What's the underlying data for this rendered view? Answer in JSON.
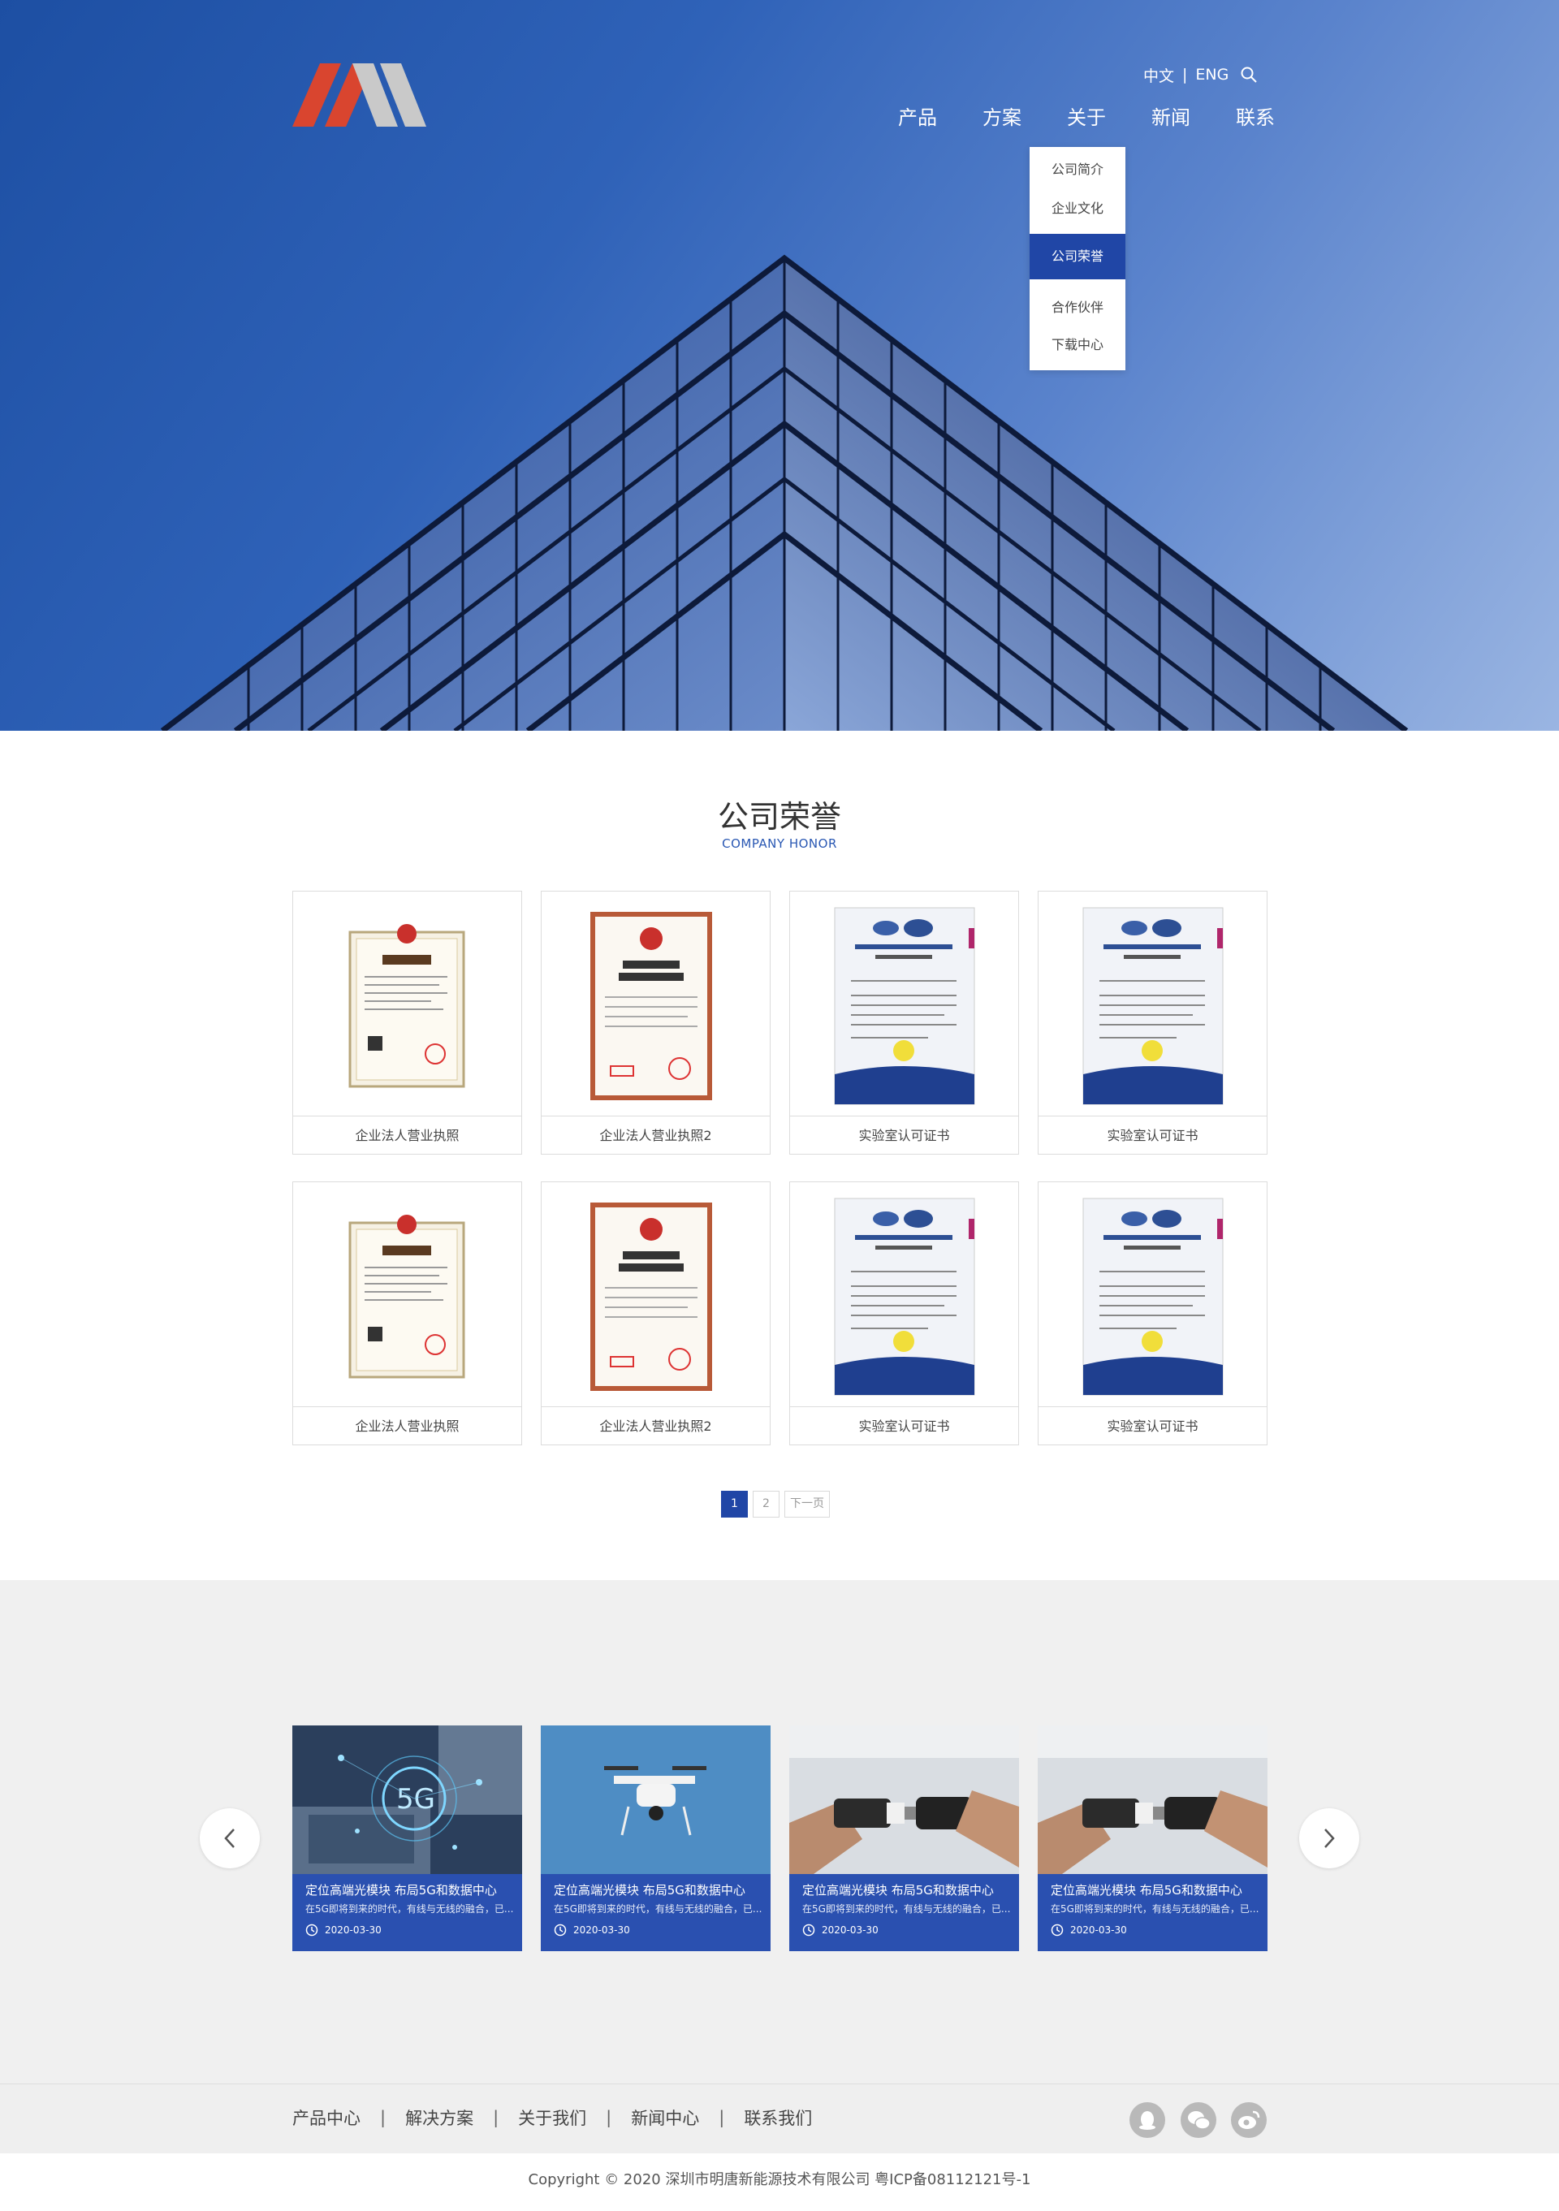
{
  "header": {
    "lang": {
      "cn": "中文",
      "sep": "|",
      "en": "ENG"
    },
    "nav": [
      "产品",
      "方案",
      "关于",
      "新闻",
      "联系"
    ],
    "dropdown": [
      "公司简介",
      "企业文化",
      "公司荣誉",
      "合作伙伴",
      "下载中心"
    ],
    "dropdown_active": "公司荣誉"
  },
  "section": {
    "title": "公司荣誉",
    "subtitle": "COMPANY HONOR"
  },
  "certificates": [
    {
      "caption": "企业法人营业执照"
    },
    {
      "caption": "企业法人营业执照2"
    },
    {
      "caption": "实验室认可证书"
    },
    {
      "caption": "实验室认可证书"
    },
    {
      "caption": "企业法人营业执照"
    },
    {
      "caption": "企业法人营业执照2"
    },
    {
      "caption": "实验室认可证书"
    },
    {
      "caption": "实验室认可证书"
    }
  ],
  "pagination": {
    "page1": "1",
    "page2": "2",
    "next": "下一页"
  },
  "news": [
    {
      "title": "定位高端光模块 布局5G和数据中心",
      "desc": "在5G即将到来的时代，有线与无线的融合，已...",
      "date": "2020-03-30",
      "image": "5g-tech"
    },
    {
      "title": "定位高端光模块 布局5G和数据中心",
      "desc": "在5G即将到来的时代，有线与无线的融合，已...",
      "date": "2020-03-30",
      "image": "drone"
    },
    {
      "title": "定位高端光模块 布局5G和数据中心",
      "desc": "在5G即将到来的时代，有线与无线的融合，已...",
      "date": "2020-03-30",
      "image": "connector-hands"
    },
    {
      "title": "定位高端光模块 布局5G和数据中心",
      "desc": "在5G即将到来的时代，有线与无线的融合，已...",
      "date": "2020-03-30",
      "image": "connector-hands"
    }
  ],
  "footer": {
    "links": [
      "产品中心",
      "解决方案",
      "关于我们",
      "新闻中心",
      "联系我们"
    ],
    "sep": "|",
    "copyright": "Copyright © 2020  深圳市明唐新能源技术有限公司  粤ICP备08112121号-1"
  },
  "colors": {
    "primary": "#2046a6",
    "news_card": "#2a50b0",
    "logo_red": "#d9452f",
    "logo_gray": "#c9c9c9"
  }
}
